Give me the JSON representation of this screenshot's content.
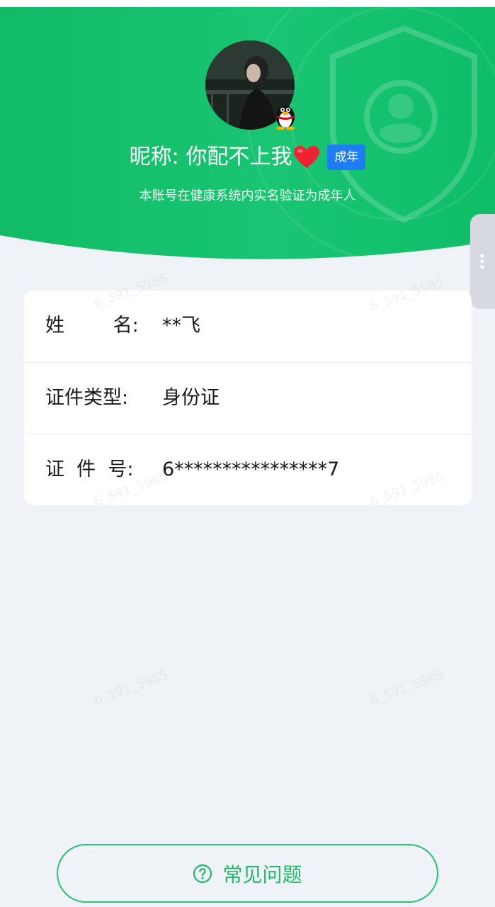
{
  "profile": {
    "nickname_label": "昵称: 你配不上我",
    "age_tag": "成年",
    "verify_note": "本账号在健康系统内实名验证为成年人"
  },
  "info": {
    "rows": [
      {
        "label": "姓        名:",
        "value": "**飞"
      },
      {
        "label": "证件类型:",
        "value": "身份证"
      },
      {
        "label": "证  件  号:",
        "value": "6****************7"
      }
    ]
  },
  "faq": {
    "label": "常见问题"
  },
  "colors": {
    "hero_green": "#14c06a",
    "accent_blue": "#1f7df3",
    "faq_green": "#23c472",
    "page_bg": "#eff2f6"
  },
  "icons": [
    "avatar",
    "qq-penguin-icon",
    "heart-icon",
    "shield-user-icon",
    "more-dots-icon",
    "question-circle-icon"
  ]
}
